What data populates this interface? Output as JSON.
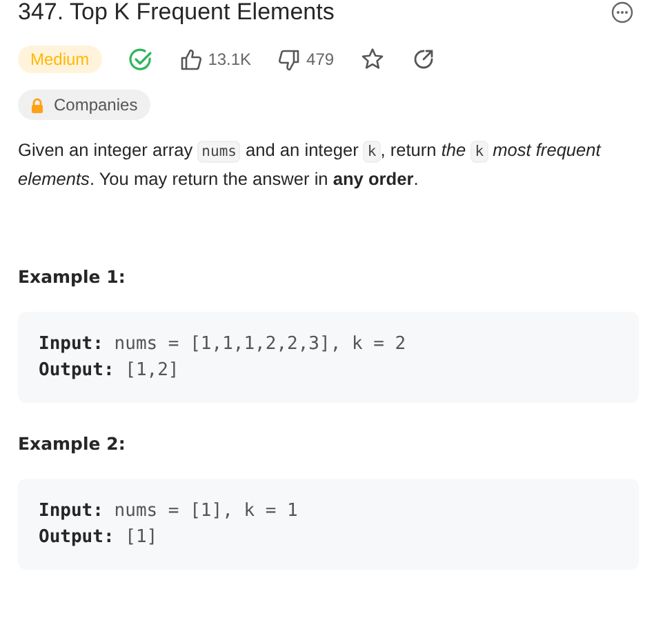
{
  "title": "347. Top K Frequent Elements",
  "difficulty": {
    "label": "Medium",
    "kind": "medium"
  },
  "solved": true,
  "likes": "13.1K",
  "dislikes": "479",
  "companies": "Companies",
  "description": [
    {
      "kind": "text",
      "text": "Given an integer array "
    },
    {
      "kind": "code",
      "text": "nums"
    },
    {
      "kind": "text",
      "text": " and an integer "
    },
    {
      "kind": "code",
      "text": "k"
    },
    {
      "kind": "text",
      "text": ", return *the* "
    },
    {
      "kind": "code",
      "text": "k"
    },
    {
      "kind": "text",
      "text": " *most frequent elements*. You may return the answer in **any order**."
    }
  ],
  "examples": [
    {
      "title": "Example 1:",
      "lines": [
        {
          "label": "Input:",
          "value": "nums = [1,1,1,2,2,3], k = 2"
        },
        {
          "label": "Output:",
          "value": "[1,2]"
        }
      ]
    },
    {
      "title": "Example 2:",
      "lines": [
        {
          "label": "Input:",
          "value": "nums = [1], k = 1"
        },
        {
          "label": "Output:",
          "value": "[1]"
        }
      ]
    }
  ]
}
